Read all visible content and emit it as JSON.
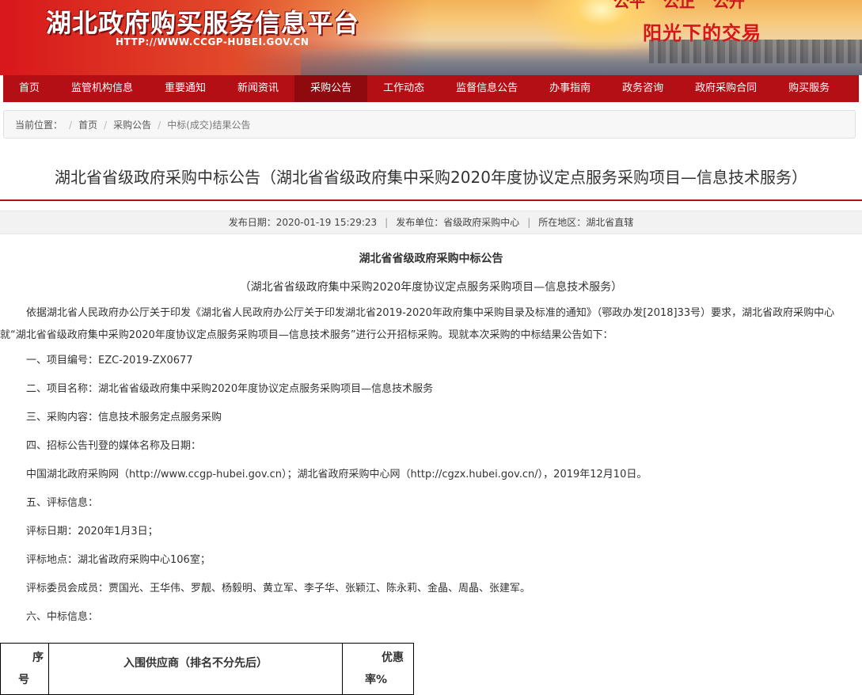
{
  "header": {
    "site_title": "湖北政府购买服务信息平台",
    "site_url": "HTTP://WWW.CCGP-HUBEI.GOV.CN",
    "slogan_top": "公平 公正 公开",
    "slogan": "阳光下的交易"
  },
  "nav": {
    "items": [
      "首页",
      "监管机构信息",
      "重要通知",
      "新闻资讯",
      "采购公告",
      "工作动态",
      "监督信息公告",
      "办事指南",
      "政务咨询",
      "政府采购合同",
      "购买服务"
    ],
    "active": "采购公告"
  },
  "breadcrumb": {
    "label": "当前位置：",
    "items": [
      "首页",
      "采购公告",
      "中标(成交)结果公告"
    ]
  },
  "article": {
    "title": "湖北省省级政府采购中标公告（湖北省省级政府集中采购2020年度协议定点服务采购项目—信息技术服务）",
    "publish_date": "发布日期：2020-01-19 15:29:23",
    "publisher": "发布单位：省级政府采购中心",
    "region": "所在地区：湖北省直辖"
  },
  "body": {
    "heading": "湖北省省级政府采购中标公告",
    "subheading": "（湖北省省级政府集中采购2020年度协议定点服务采购项目—信息技术服务）",
    "intro": "依据湖北省人民政府办公厅关于印发《湖北省人民政府办公厅关于印发湖北省2019-2020年政府集中采购目录及标准的通知》（鄂政办发[2018]33号）要求，湖北省政府采购中心就“湖北省省级政府集中采购2020年度协议定点服务采购项目—信息技术服务”进行公开招标采购。现就本次采购的中标结果公告如下：",
    "lines": [
      "一、项目编号：EZC-2019-ZX0677",
      "二、项目名称：湖北省省级政府集中采购2020年度协议定点服务采购项目—信息技术服务",
      "三、采购内容：信息技术服务定点服务采购",
      "四、招标公告刊登的媒体名称及日期：",
      "中国湖北政府采购网（http://www.ccgp-hubei.gov.cn）；湖北省政府采购中心网（http://cgzx.hubei.gov.cn/），2019年12月10日。",
      "五、评标信息：",
      "评标日期：2020年1月3日；",
      "评标地点：湖北省政府采购中心106室；",
      "评标委员会成员：贾国光、王华伟、罗靓、杨毅明、黄立军、李子华、张颖江、陈永莉、金晶、周晶、张建军。",
      "六、中标信息："
    ]
  },
  "table": {
    "col_no_1": "序",
    "col_no_2": "号",
    "col_supplier": "入围供应商（排名不分先后）",
    "col_discount_1": "优惠",
    "col_discount_2": "率%"
  },
  "colors": {
    "brand_red": "#b40f15",
    "nav_active": "#8e0a0f"
  }
}
